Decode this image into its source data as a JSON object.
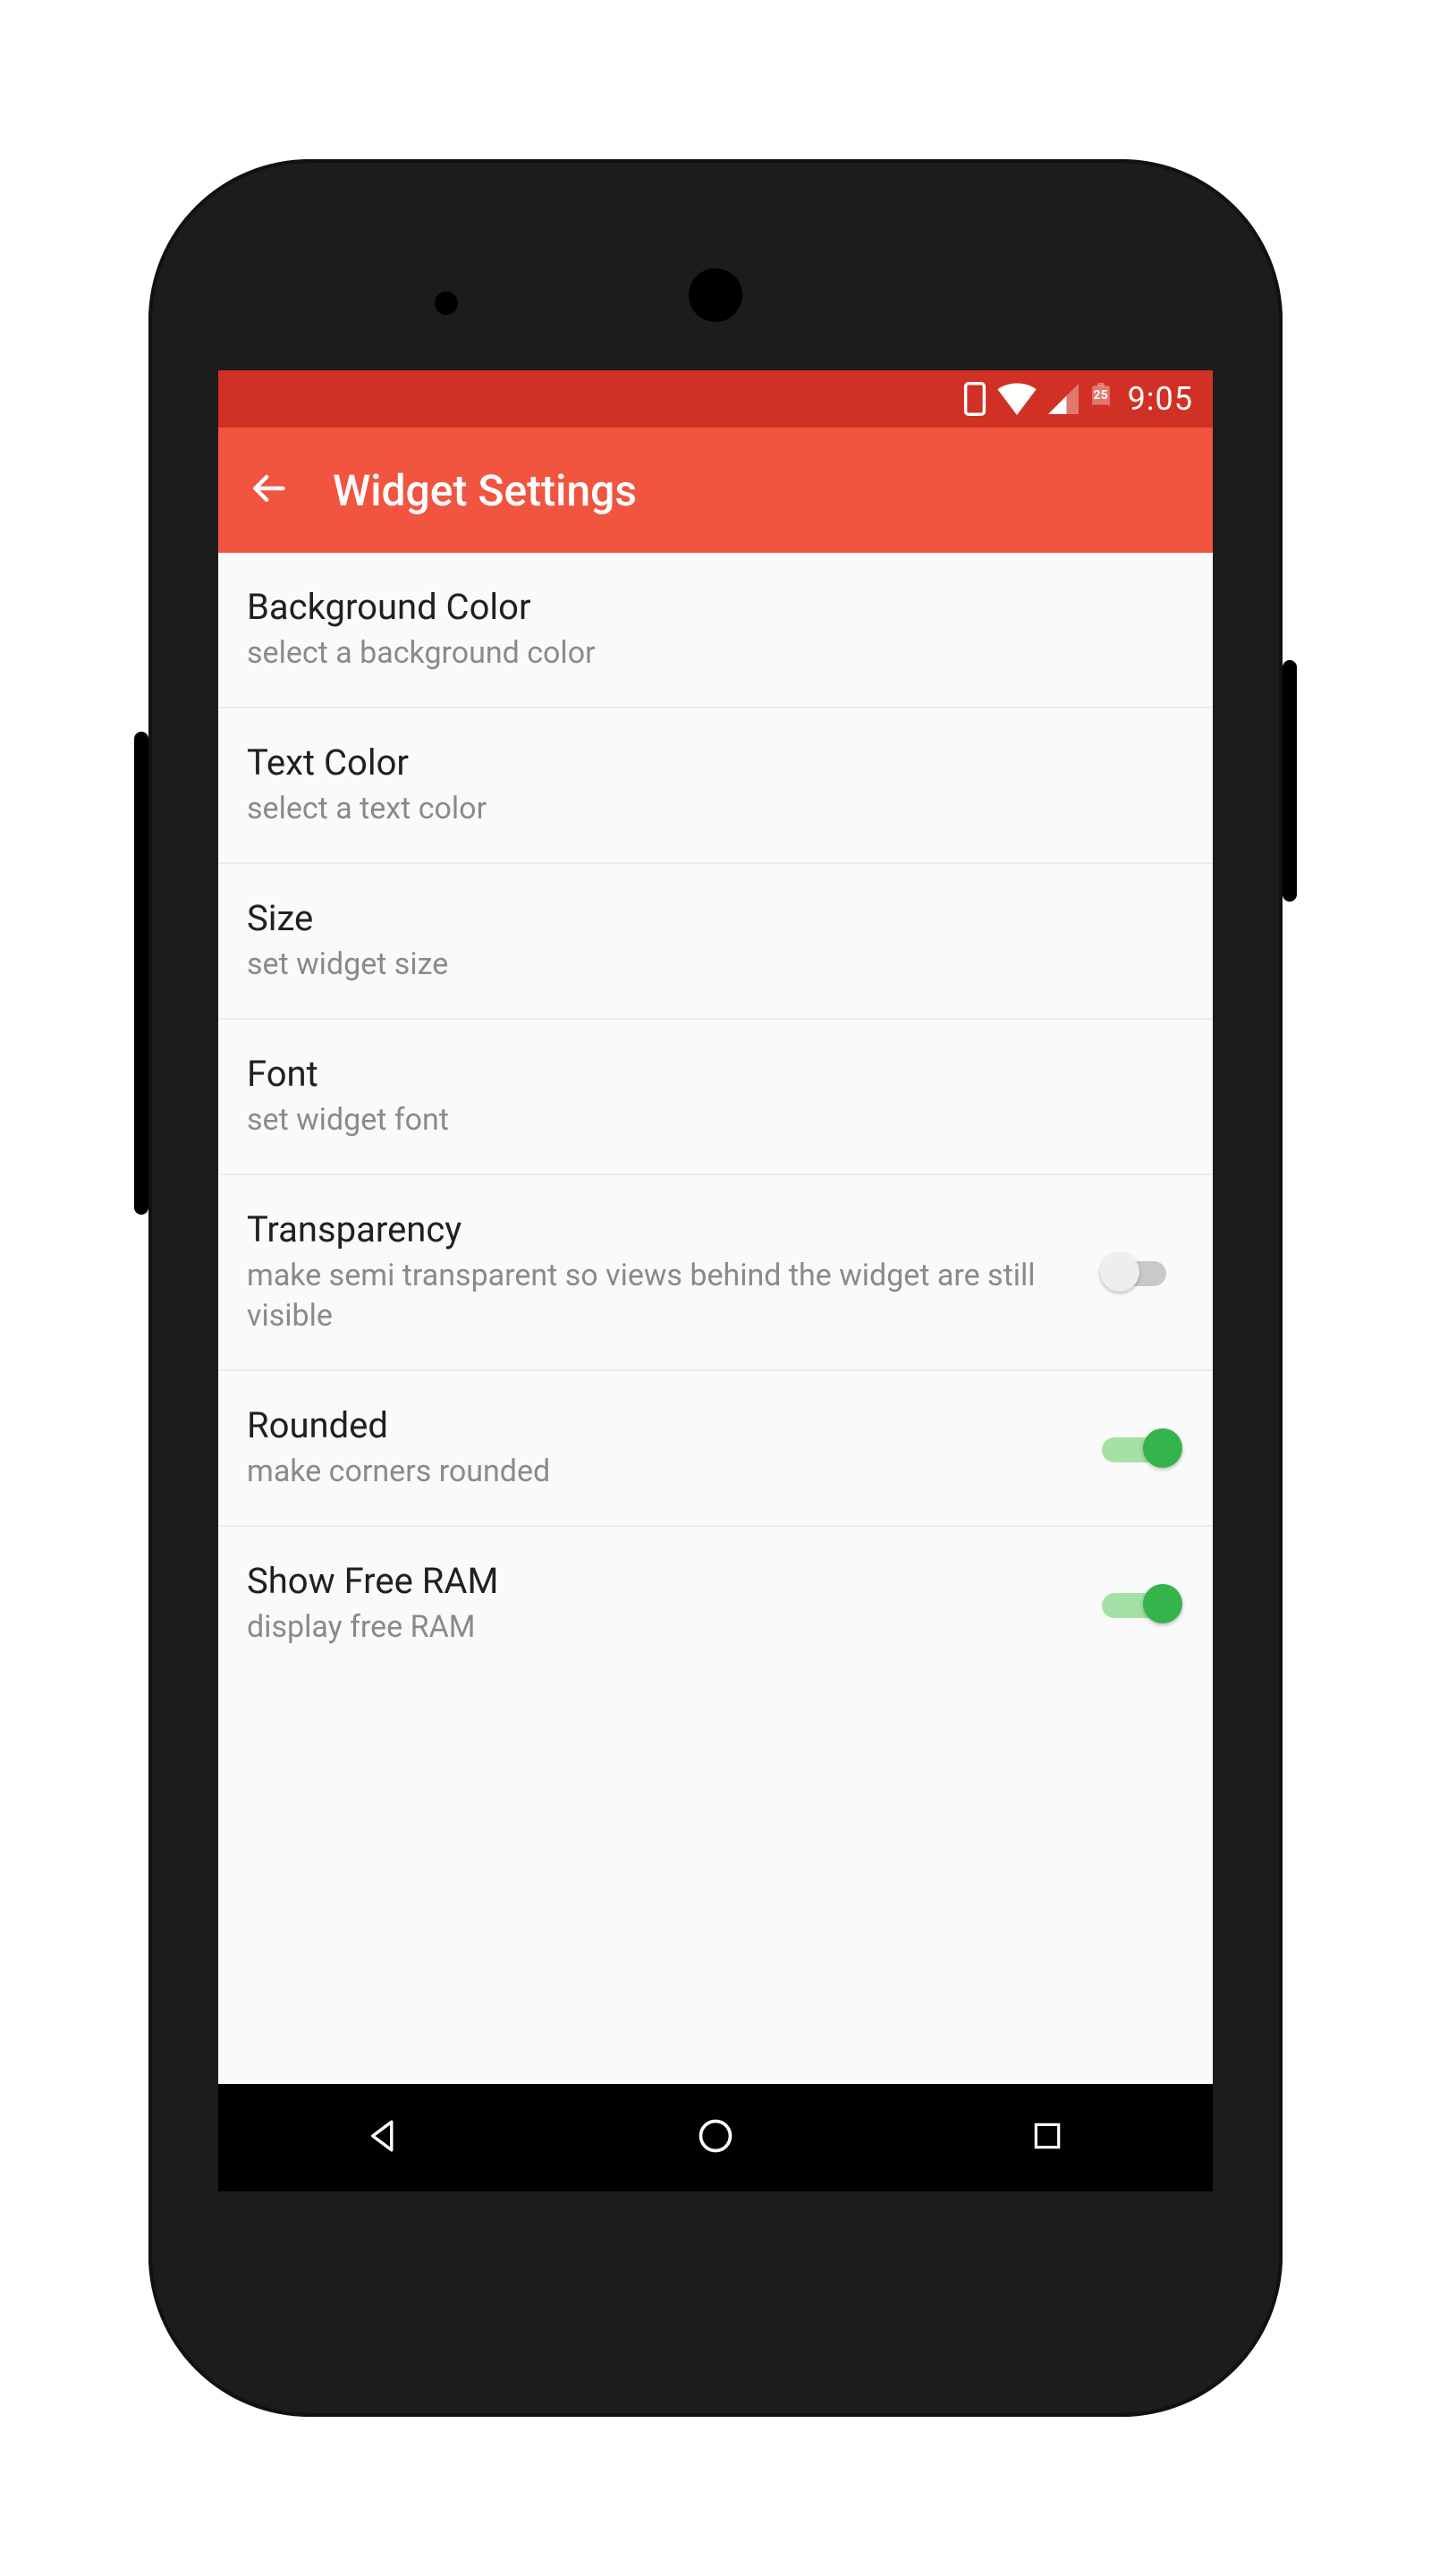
{
  "statusbar": {
    "clock": "9:05",
    "battery_label": "25"
  },
  "appbar": {
    "title": "Widget Settings"
  },
  "settings": {
    "rows": [
      {
        "title": "Background Color",
        "subtitle": "select a background color",
        "has_toggle": false
      },
      {
        "title": "Text Color",
        "subtitle": "select a text color",
        "has_toggle": false
      },
      {
        "title": "Size",
        "subtitle": "set widget size",
        "has_toggle": false
      },
      {
        "title": "Font",
        "subtitle": "set widget font",
        "has_toggle": false
      },
      {
        "title": "Transparency",
        "subtitle": "make semi transparent so views behind the widget are still visible",
        "has_toggle": true,
        "on": false
      },
      {
        "title": "Rounded",
        "subtitle": "make corners rounded",
        "has_toggle": true,
        "on": true
      },
      {
        "title": "Show Free RAM",
        "subtitle": "display free RAM",
        "has_toggle": true,
        "on": true
      }
    ]
  }
}
